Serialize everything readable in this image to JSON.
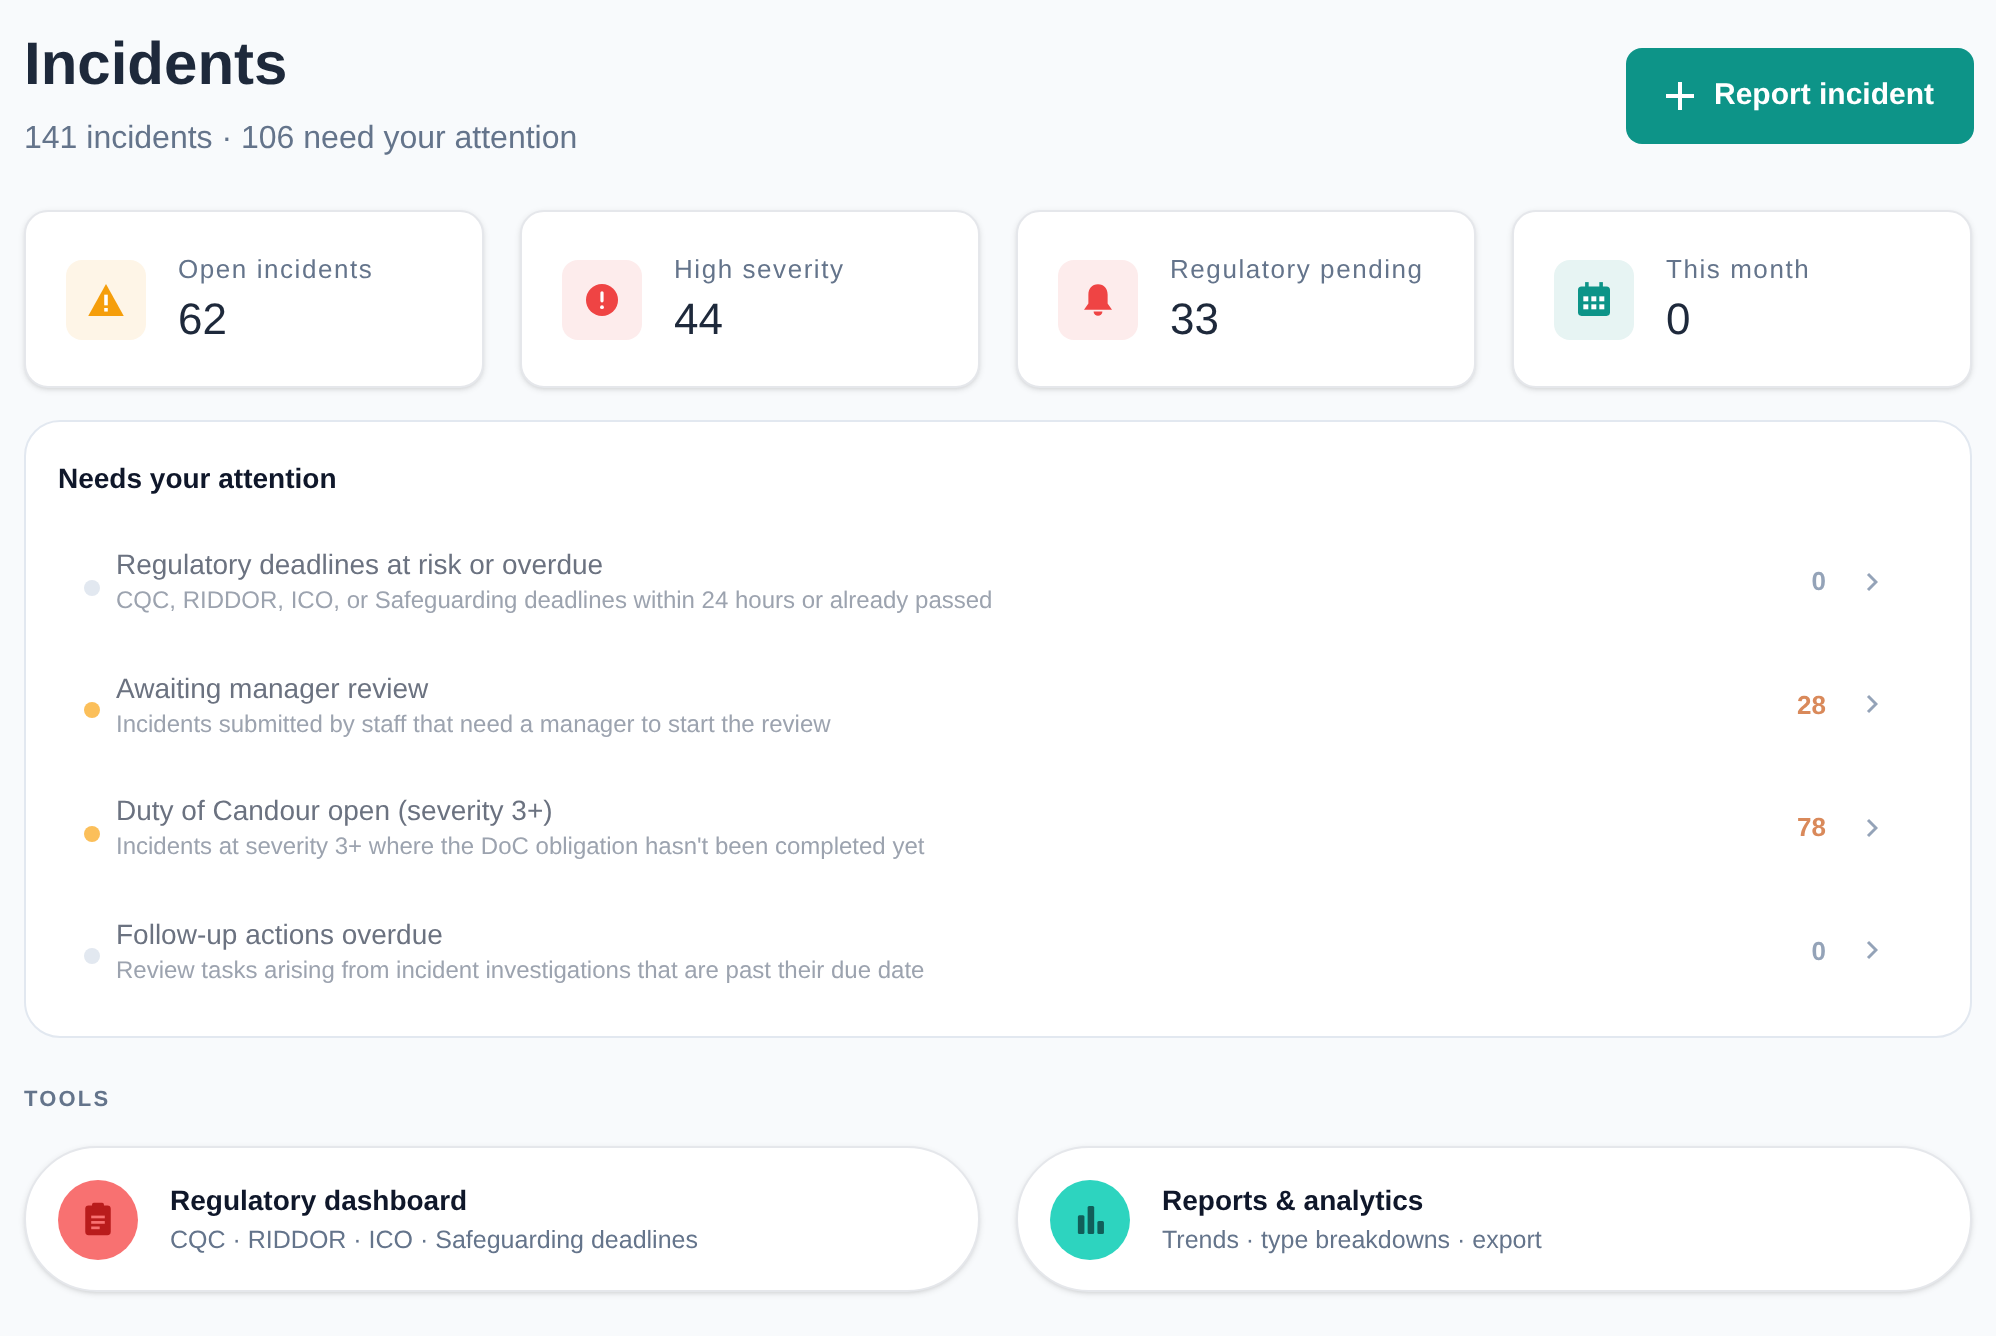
{
  "header": {
    "title": "Incidents",
    "subtitle": "141 incidents · 106 need your attention",
    "action": {
      "label": "Report incident"
    }
  },
  "stats": [
    {
      "kind": "warning",
      "label": "Open incidents",
      "value": "62",
      "color": "#f59e0b"
    },
    {
      "kind": "alert",
      "label": "High severity",
      "value": "44",
      "color": "#ef4444"
    },
    {
      "kind": "bell",
      "label": "Regulatory pending",
      "value": "33",
      "color": "#ef4444"
    },
    {
      "kind": "calendar",
      "label": "This month",
      "value": "0",
      "color": "#0d9488"
    }
  ],
  "attention": {
    "title": "Needs your attention",
    "items": [
      {
        "title": "Regulatory deadlines at risk or overdue",
        "description": "CQC, RIDDOR, ICO, or Safeguarding deadlines within 24 hours or already passed",
        "count": "0",
        "color": "#e2e8f0",
        "active": false
      },
      {
        "title": "Awaiting manager review",
        "description": "Incidents submitted by staff that need a manager to start the review",
        "count": "28",
        "color": "#fbbf5a",
        "active": true
      },
      {
        "title": "Duty of Candour open (severity 3+)",
        "description": "Incidents at severity 3+ where the DoC obligation hasn't been completed yet",
        "count": "78",
        "color": "#fbbf5a",
        "active": true
      },
      {
        "title": "Follow-up actions overdue",
        "description": "Review tasks arising from incident investigations that are past their due date",
        "count": "0",
        "color": "#e2e8f0",
        "active": false
      }
    ]
  },
  "tools": {
    "heading": "TOOLS",
    "items": [
      {
        "kind": "clipboard",
        "title": "Regulatory dashboard",
        "description": "CQC · RIDDOR · ICO · Safeguarding deadlines",
        "color": "#f87171"
      },
      {
        "kind": "chart",
        "title": "Reports & analytics",
        "description": "Trends · type breakdowns · export",
        "color": "#2dd4bf"
      }
    ]
  }
}
